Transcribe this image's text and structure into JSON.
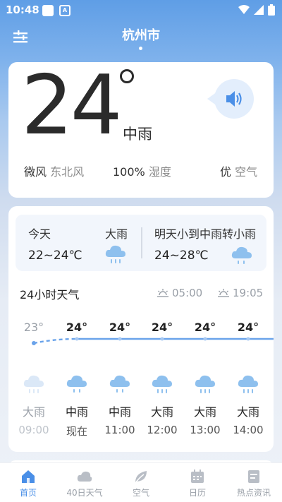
{
  "status_bar": {
    "time": "10:48",
    "notif_letter": "A"
  },
  "header": {
    "city": "杭州市"
  },
  "current": {
    "temperature": "24",
    "condition": "中雨",
    "wind_value": "微风",
    "wind_label": "东北风",
    "humidity_value": "100%",
    "humidity_label": "湿度",
    "air_value": "优",
    "air_label": "空气"
  },
  "days": [
    {
      "name": "今天",
      "condition": "大雨",
      "range": "22~24℃"
    },
    {
      "name": "明天",
      "condition": "小到中雨转小雨",
      "range": "24~28℃"
    }
  ],
  "hourly": {
    "title": "24小时天气",
    "sunrise": "05:00",
    "sunset": "19:05",
    "items": [
      {
        "temp": "23°",
        "cond": "大雨",
        "time": "09:00"
      },
      {
        "temp": "24°",
        "cond": "中雨",
        "time": "现在"
      },
      {
        "temp": "24°",
        "cond": "中雨",
        "time": "11:00"
      },
      {
        "temp": "24°",
        "cond": "大雨",
        "time": "12:00"
      },
      {
        "temp": "24°",
        "cond": "大雨",
        "time": "13:00"
      },
      {
        "temp": "24°",
        "cond": "大雨",
        "time": "14:00"
      }
    ]
  },
  "nav": [
    {
      "label": "首页",
      "icon": "home-icon"
    },
    {
      "label": "40日天气",
      "icon": "cloud-icon"
    },
    {
      "label": "空气",
      "icon": "leaf-icon"
    },
    {
      "label": "日历",
      "icon": "calendar-icon"
    },
    {
      "label": "热点资讯",
      "icon": "news-icon"
    }
  ],
  "colors": {
    "accent": "#4a8fe7",
    "rain_icon": "#8ec0ee",
    "curve": "#6aa3ea"
  }
}
